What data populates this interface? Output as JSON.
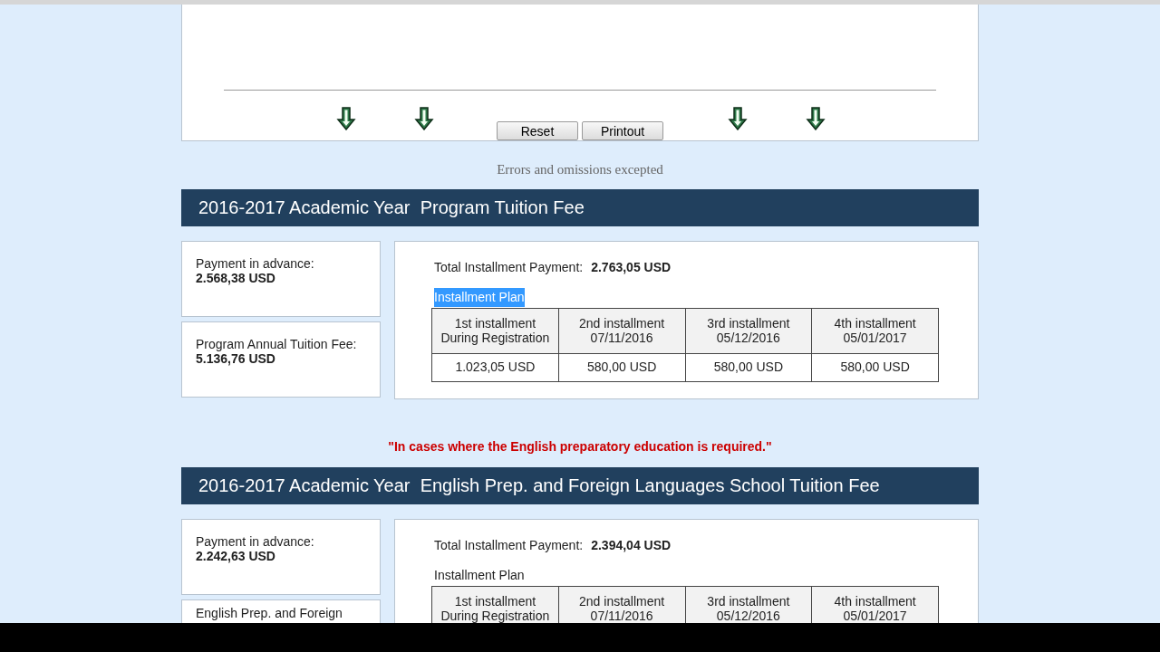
{
  "top_panel": {
    "buttons": [
      "Reset",
      "Printout"
    ]
  },
  "disclaimer": "Errors and omissions excepted",
  "sections": [
    {
      "title": "2016-2017 Academic Year  Program Tuition Fee",
      "advance_label": "Payment in advance:",
      "advance_value": "2.568,38 USD",
      "annual_label": "Program Annual Tuition Fee:",
      "annual_value": "5.136,76 USD",
      "total_label": "Total Installment Payment:",
      "total_value": "2.763,05 USD",
      "plan_label": "Installment Plan",
      "plan_label_highlighted": true,
      "columns": [
        [
          "1st installment",
          "During Registration"
        ],
        [
          "2nd installment",
          "07/11/2016"
        ],
        [
          "3rd installment",
          "05/12/2016"
        ],
        [
          "4th installment",
          "05/01/2017"
        ]
      ],
      "amounts": [
        "1.023,05 USD",
        "580,00 USD",
        "580,00 USD",
        "580,00 USD"
      ]
    },
    {
      "note": "\"In cases where the English preparatory education is required.\"",
      "title": "2016-2017 Academic Year  English Prep. and Foreign Languages School Tuition Fee",
      "advance_label": "Payment in advance:",
      "advance_value": "2.242,63 USD",
      "annual_label": "English Prep. and Foreign",
      "total_label": "Total Installment Payment:",
      "total_value": "2.394,04 USD",
      "plan_label": "Installment Plan",
      "plan_label_highlighted": false,
      "columns": [
        [
          "1st installment",
          "During Registration"
        ],
        [
          "2nd installment",
          "07/11/2016"
        ],
        [
          "3rd installment",
          "05/12/2016"
        ],
        [
          "4th installment",
          "05/01/2017"
        ]
      ]
    }
  ]
}
